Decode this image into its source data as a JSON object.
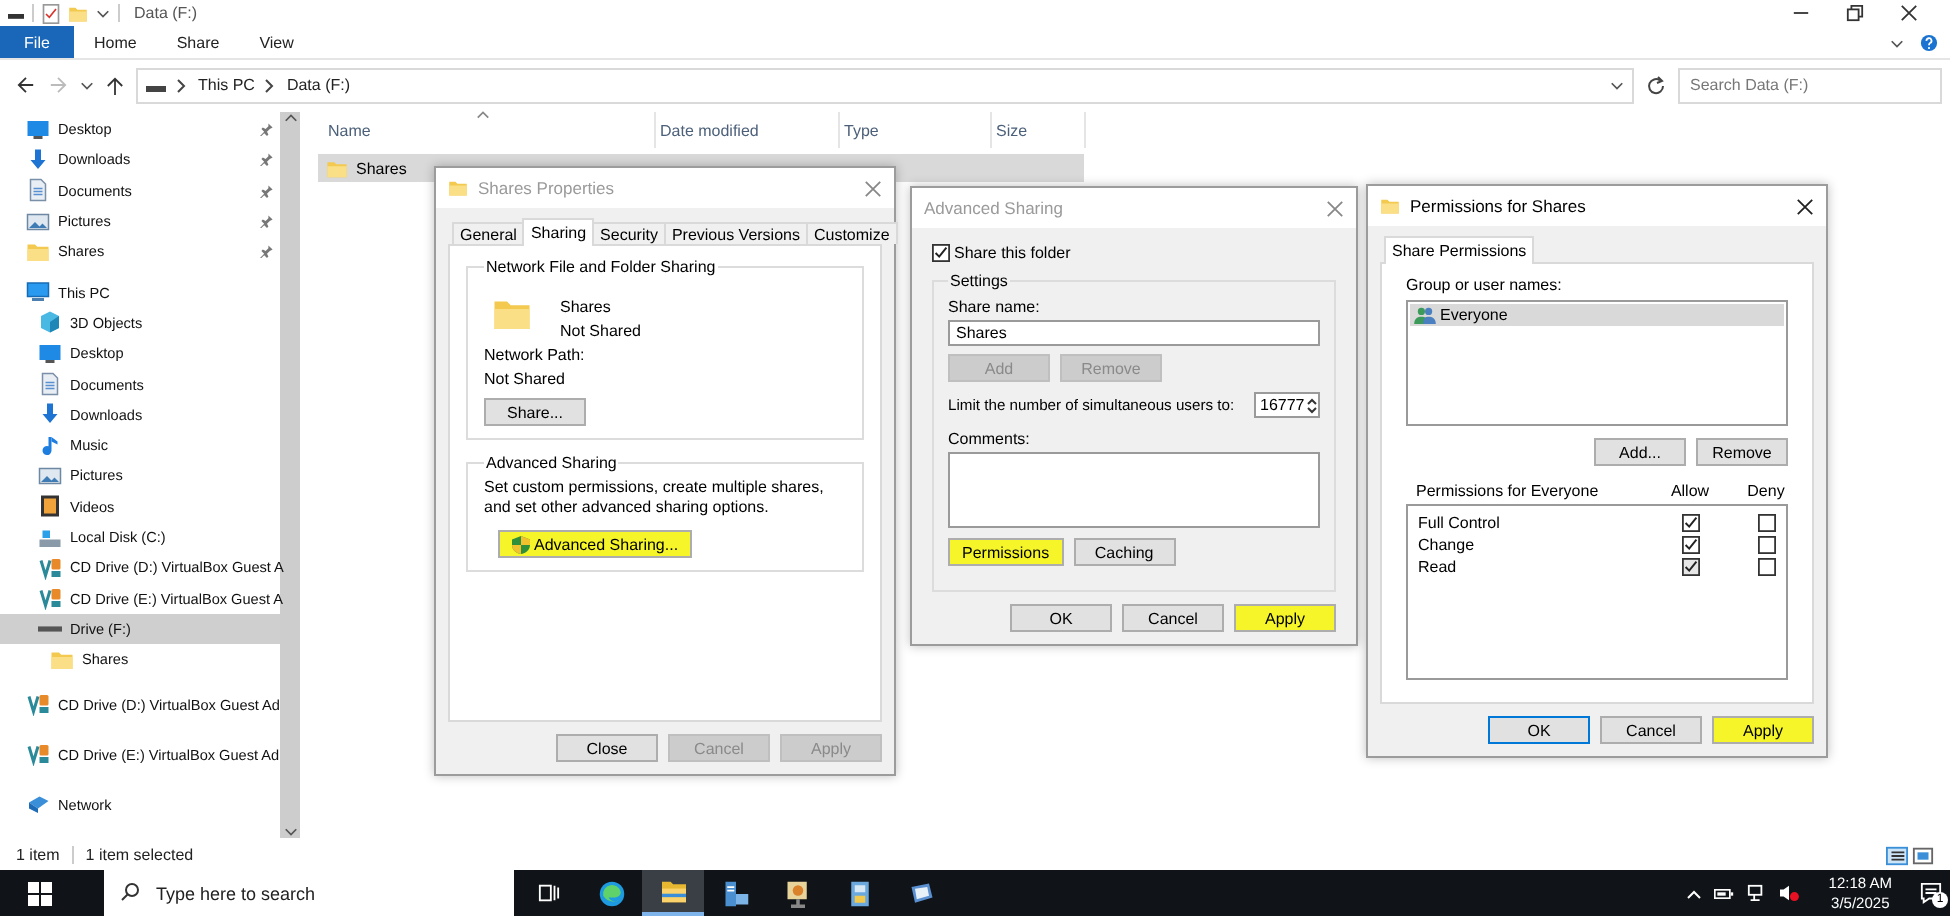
{
  "window": {
    "title": "Data (F:)"
  },
  "ribbon": {
    "tabs": [
      {
        "label": "File",
        "kind": "file"
      },
      {
        "label": "Home",
        "kind": "tab"
      },
      {
        "label": "Share",
        "kind": "tab"
      },
      {
        "label": "View",
        "kind": "tab"
      }
    ]
  },
  "address_bar": {
    "path": [
      "This PC",
      "Data (F:)"
    ],
    "search_placeholder": "Search Data (F:)"
  },
  "navigation": [
    {
      "label": "Desktop",
      "kind": "desktop",
      "pinned": true,
      "selected": false
    },
    {
      "label": "Downloads",
      "kind": "downloads",
      "pinned": true,
      "selected": false
    },
    {
      "label": "Documents",
      "kind": "documents",
      "pinned": true,
      "selected": false
    },
    {
      "label": "Pictures",
      "kind": "pictures",
      "pinned": true,
      "selected": false
    },
    {
      "label": "Shares",
      "kind": "folder",
      "pinned": true,
      "selected": false
    },
    {
      "label": "This PC",
      "kind": "pc",
      "pinned": false,
      "selected": false,
      "children": [
        {
          "label": "3D Objects",
          "kind": "cube",
          "pinned": false,
          "selected": false
        },
        {
          "label": "Desktop",
          "kind": "desktop",
          "pinned": false,
          "selected": false
        },
        {
          "label": "Documents",
          "kind": "documents",
          "pinned": false,
          "selected": false
        },
        {
          "label": "Downloads",
          "kind": "downloads",
          "pinned": false,
          "selected": false
        },
        {
          "label": "Music",
          "kind": "music",
          "pinned": false,
          "selected": false
        },
        {
          "label": "Pictures",
          "kind": "pictures",
          "pinned": false,
          "selected": false
        },
        {
          "label": "Videos",
          "kind": "videos",
          "pinned": false,
          "selected": false
        },
        {
          "label": "Local Disk (C:)",
          "kind": "disk",
          "pinned": false,
          "selected": false
        },
        {
          "label": "CD Drive (D:) VirtualBox Guest A",
          "kind": "cd",
          "pinned": false,
          "selected": false
        },
        {
          "label": "CD Drive (E:) VirtualBox Guest A",
          "kind": "cd",
          "pinned": false,
          "selected": false
        },
        {
          "label": "Drive (F:)",
          "kind": "drive",
          "pinned": false,
          "selected": true,
          "children": [
            {
              "label": "Shares",
              "kind": "folder",
              "pinned": false,
              "selected": false
            }
          ]
        }
      ]
    },
    {
      "label": "CD Drive (D:) VirtualBox Guest Ad",
      "kind": "cd",
      "pinned": false,
      "selected": false
    },
    {
      "label": "CD Drive (E:) VirtualBox Guest Ad",
      "kind": "cd",
      "pinned": false,
      "selected": false
    },
    {
      "label": "Network",
      "kind": "network",
      "pinned": false,
      "selected": false
    }
  ],
  "file_list": {
    "columns": [
      "Name",
      "Date modified",
      "Type",
      "Size"
    ],
    "rows": [
      {
        "name": "Shares",
        "selected": true
      }
    ]
  },
  "status_bar": {
    "item_count": "1 item",
    "selection": "1 item selected"
  },
  "shares_properties": {
    "title": "Shares Properties",
    "active": false,
    "tabs": [
      {
        "label": "General",
        "selected": false
      },
      {
        "label": "Sharing",
        "selected": true
      },
      {
        "label": "Security",
        "selected": false
      },
      {
        "label": "Previous Versions",
        "selected": false
      },
      {
        "label": "Customize",
        "selected": false
      }
    ],
    "network_sharing": {
      "heading": "Network File and Folder Sharing",
      "folder_name": "Shares",
      "folder_status": "Not Shared",
      "path_label": "Network Path:",
      "path_value": "Not Shared",
      "share_button": {
        "label": "Share...",
        "disabled": false,
        "highlighted": false
      }
    },
    "advanced_sharing": {
      "heading": "Advanced Sharing",
      "description": "Set custom permissions, create multiple shares, and set other advanced sharing options.",
      "button": {
        "label": "Advanced Sharing...",
        "disabled": false,
        "highlighted": true
      }
    },
    "buttons": [
      {
        "label": "Close",
        "disabled": false,
        "highlighted": false
      },
      {
        "label": "Cancel",
        "disabled": true,
        "highlighted": false
      },
      {
        "label": "Apply",
        "disabled": true,
        "highlighted": false
      }
    ]
  },
  "advanced_sharing": {
    "title": "Advanced Sharing",
    "active": false,
    "share_checkbox": {
      "label": "Share this folder",
      "checked": true
    },
    "settings": {
      "heading": "Settings",
      "share_name_label": "Share name:",
      "share_name": "Shares",
      "name_buttons": [
        {
          "label": "Add",
          "disabled": true,
          "highlighted": false
        },
        {
          "label": "Remove",
          "disabled": true,
          "highlighted": false
        }
      ],
      "limit_label": "Limit the number of simultaneous users to:",
      "limit_value": "16777",
      "comments_label": "Comments:",
      "buttons": [
        {
          "label": "Permissions",
          "disabled": false,
          "highlighted": true
        },
        {
          "label": "Caching",
          "disabled": false,
          "highlighted": false
        }
      ]
    },
    "buttons": [
      {
        "label": "OK",
        "disabled": false,
        "highlighted": false
      },
      {
        "label": "Cancel",
        "disabled": false,
        "highlighted": false
      },
      {
        "label": "Apply",
        "disabled": false,
        "highlighted": true
      }
    ]
  },
  "permissions": {
    "title": "Permissions for Shares",
    "active": true,
    "tabs": [
      {
        "label": "Share Permissions",
        "selected": true
      }
    ],
    "groups_label": "Group or user names:",
    "groups": [
      {
        "name": "Everyone",
        "selected": true
      }
    ],
    "group_buttons": [
      {
        "label": "Add...",
        "disabled": false,
        "highlighted": false
      },
      {
        "label": "Remove",
        "disabled": false,
        "highlighted": false
      }
    ],
    "permissions_label": "Permissions for Everyone",
    "allow_label": "Allow",
    "deny_label": "Deny",
    "permissions": [
      {
        "name": "Full Control",
        "allow": true,
        "deny": false
      },
      {
        "name": "Change",
        "allow": true,
        "deny": false
      },
      {
        "name": "Read",
        "allow": true,
        "deny": false
      }
    ],
    "buttons": [
      {
        "label": "OK",
        "default": true,
        "disabled": false,
        "highlighted": false
      },
      {
        "label": "Cancel",
        "default": false,
        "disabled": false,
        "highlighted": false
      },
      {
        "label": "Apply",
        "default": false,
        "disabled": false,
        "highlighted": true
      }
    ]
  },
  "taskbar": {
    "search_placeholder": "Type here to search",
    "apps": [
      {
        "kind": "task-view",
        "active": false
      },
      {
        "kind": "browser",
        "active": false
      },
      {
        "kind": "explorer",
        "active": true
      },
      {
        "kind": "server",
        "active": false
      },
      {
        "kind": "user",
        "active": false
      },
      {
        "kind": "cabinet",
        "active": false
      },
      {
        "kind": "window",
        "active": false
      }
    ],
    "time": "12:18 AM",
    "date": "3/5/2025",
    "notification_count": "1"
  }
}
